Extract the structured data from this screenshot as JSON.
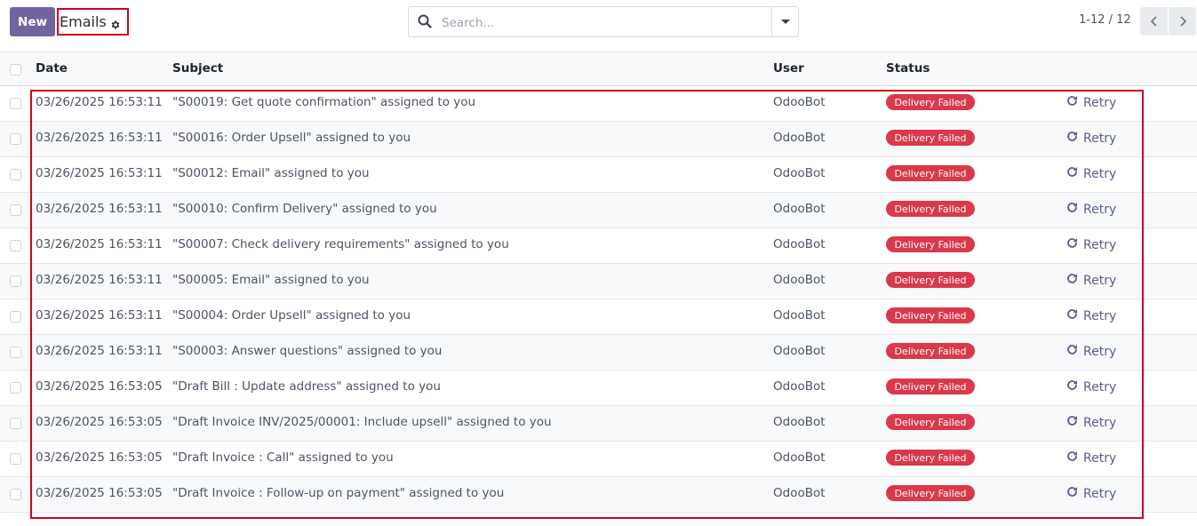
{
  "control_panel": {
    "new_label": "New",
    "title": "Emails",
    "search_placeholder": "Search...",
    "pager_value": "1-12 / 12"
  },
  "columns": {
    "date": "Date",
    "subject": "Subject",
    "user": "User",
    "status": "Status"
  },
  "colors": {
    "primary": "#71639e",
    "danger": "#d9394a",
    "highlight": "#d0021b"
  },
  "rows": [
    {
      "date": "03/26/2025 16:53:11",
      "subject": "\"S00019: Get quote confirmation\" assigned to you",
      "user": "OdooBot",
      "status": "Delivery Failed",
      "action": "Retry"
    },
    {
      "date": "03/26/2025 16:53:11",
      "subject": "\"S00016: Order Upsell\" assigned to you",
      "user": "OdooBot",
      "status": "Delivery Failed",
      "action": "Retry"
    },
    {
      "date": "03/26/2025 16:53:11",
      "subject": "\"S00012: Email\" assigned to you",
      "user": "OdooBot",
      "status": "Delivery Failed",
      "action": "Retry"
    },
    {
      "date": "03/26/2025 16:53:11",
      "subject": "\"S00010: Confirm Delivery\" assigned to you",
      "user": "OdooBot",
      "status": "Delivery Failed",
      "action": "Retry"
    },
    {
      "date": "03/26/2025 16:53:11",
      "subject": "\"S00007: Check delivery requirements\" assigned to you",
      "user": "OdooBot",
      "status": "Delivery Failed",
      "action": "Retry"
    },
    {
      "date": "03/26/2025 16:53:11",
      "subject": "\"S00005: Email\" assigned to you",
      "user": "OdooBot",
      "status": "Delivery Failed",
      "action": "Retry"
    },
    {
      "date": "03/26/2025 16:53:11",
      "subject": "\"S00004: Order Upsell\" assigned to you",
      "user": "OdooBot",
      "status": "Delivery Failed",
      "action": "Retry"
    },
    {
      "date": "03/26/2025 16:53:11",
      "subject": "\"S00003: Answer questions\" assigned to you",
      "user": "OdooBot",
      "status": "Delivery Failed",
      "action": "Retry"
    },
    {
      "date": "03/26/2025 16:53:05",
      "subject": "\"Draft Bill : Update address\" assigned to you",
      "user": "OdooBot",
      "status": "Delivery Failed",
      "action": "Retry"
    },
    {
      "date": "03/26/2025 16:53:05",
      "subject": "\"Draft Invoice INV/2025/00001: Include upsell\" assigned to you",
      "user": "OdooBot",
      "status": "Delivery Failed",
      "action": "Retry"
    },
    {
      "date": "03/26/2025 16:53:05",
      "subject": "\"Draft Invoice : Call\" assigned to you",
      "user": "OdooBot",
      "status": "Delivery Failed",
      "action": "Retry"
    },
    {
      "date": "03/26/2025 16:53:05",
      "subject": "\"Draft Invoice : Follow-up on payment\" assigned to you",
      "user": "OdooBot",
      "status": "Delivery Failed",
      "action": "Retry"
    }
  ]
}
